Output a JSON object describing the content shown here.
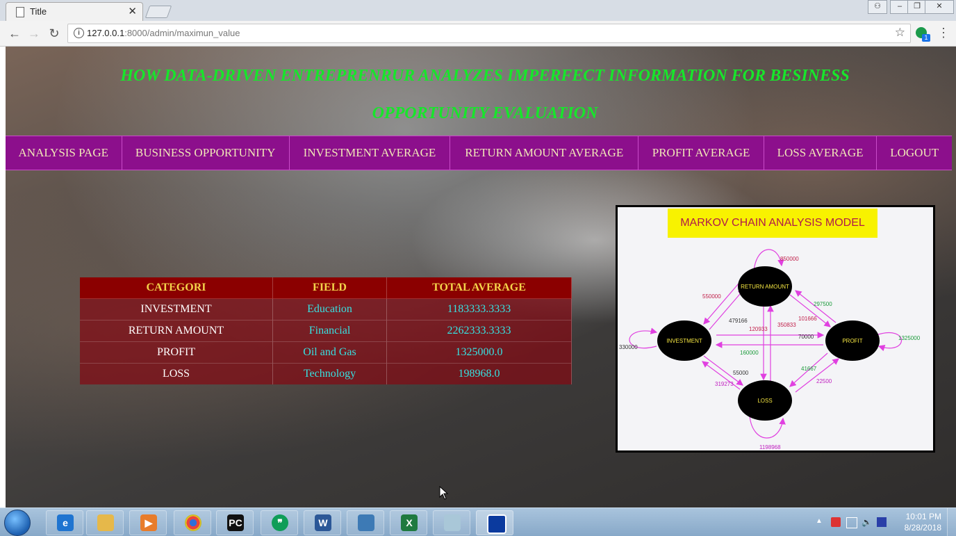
{
  "browser": {
    "tab_title": "Title",
    "url_host": "127.0.0.1",
    "url_path": ":8000/admin/maximun_value",
    "extension_badge": "1"
  },
  "page": {
    "headline_line1": "HOW DATA-DRIVEN ENTREPRENRUR ANALYZES IMPERFECT INFORMATION FOR BESINESS",
    "headline_line2": "OPPORTUNITY EVALUATION",
    "nav": [
      {
        "label": "ANALYSIS PAGE"
      },
      {
        "label": "BUSINESS OPPORTUNITY"
      },
      {
        "label": "INVESTMENT AVERAGE"
      },
      {
        "label": "RETURN AMOUNT AVERAGE"
      },
      {
        "label": "PROFIT AVERAGE"
      },
      {
        "label": "LOSS AVERAGE"
      },
      {
        "label": "LOGOUT"
      }
    ],
    "table": {
      "headers": [
        "CATEGORI",
        "FIELD",
        "TOTAL AVERAGE"
      ],
      "rows": [
        {
          "category": "INVESTMENT",
          "field": "Education",
          "total": "1183333.3333"
        },
        {
          "category": "RETURN AMOUNT",
          "field": "Financial",
          "total": "2262333.3333"
        },
        {
          "category": "PROFIT",
          "field": "Oil and Gas",
          "total": "1325000.0"
        },
        {
          "category": "LOSS",
          "field": "Technology",
          "total": "198968.0"
        }
      ]
    },
    "markov": {
      "title": "MARKOV CHAIN  ANALYSIS MODEL",
      "nodes": {
        "return": "RETURN AMOUNT",
        "investment": "INVESTMENT",
        "profit": "PROFIT",
        "loss": "LOSS"
      },
      "edge_labels": {
        "return_self": "850000",
        "inv_to_ret": "550000",
        "ret_to_inv": "479166",
        "ret_mid1": "120933",
        "ret_mid2": "350833",
        "ret_profit1": "101666",
        "profit_ret": "297500",
        "inv_profit": "70000",
        "profit_inv": "160000",
        "profit_self": "1325000",
        "inv_self": "330000",
        "loss_inv": "55000",
        "inv_loss": "319273",
        "profit_loss": "41667",
        "loss_profit": "22500",
        "loss_self": "1198968"
      },
      "colors": {
        "band": "#f8f200",
        "title": "#b01a4b",
        "node": "#000000",
        "edge": "#e040e0"
      }
    }
  },
  "taskbar": {
    "time": "10:01 PM",
    "date": "8/28/2018",
    "apps": [
      {
        "name": "Internet Explorer",
        "icon": "ie-icon"
      },
      {
        "name": "File Explorer",
        "icon": "folder-icon"
      },
      {
        "name": "Media Player",
        "icon": "media-player-icon"
      },
      {
        "name": "Chrome",
        "icon": "chrome-icon"
      },
      {
        "name": "PyCharm",
        "icon": "pycharm-icon"
      },
      {
        "name": "Hangouts",
        "icon": "hangouts-icon"
      },
      {
        "name": "Word",
        "icon": "word-icon"
      },
      {
        "name": "Photos",
        "icon": "photo-viewer-icon"
      },
      {
        "name": "Excel",
        "icon": "excel-icon"
      },
      {
        "name": "Notes",
        "icon": "notes-icon"
      },
      {
        "name": "Remote Desktop",
        "icon": "remote-desktop-icon"
      }
    ]
  }
}
